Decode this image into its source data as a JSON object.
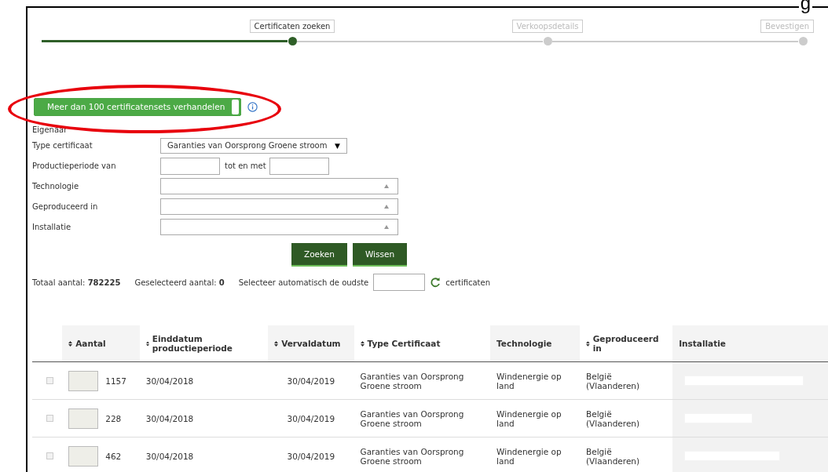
{
  "caption_fragment": "g",
  "steps": [
    {
      "label": "Certificaten zoeken",
      "selected": true
    },
    {
      "label": "Verkoopsdetails",
      "selected": false
    },
    {
      "label": "Bevestigen",
      "selected": false
    }
  ],
  "bulk_toggle": {
    "label": "Meer dan 100 certificatensets verhandelen",
    "on": true
  },
  "annotation": {
    "highlighted": true
  },
  "form": {
    "owner_label": "Eigenaar",
    "type_label": "Type certificaat",
    "type_value": "Garanties van Oorsprong Groene stroom",
    "type_arrow": "▼",
    "period_label": "Productieperiode van",
    "period_to_label": "tot en met",
    "fields": [
      {
        "label": "Technologie"
      },
      {
        "label": "Geproduceerd in"
      },
      {
        "label": "Installatie"
      }
    ]
  },
  "buttons": [
    "Zoeken",
    "Wissen"
  ],
  "summary": {
    "total_label": "Totaal aantal:",
    "total": "782225",
    "selected_label": "Geselecteerd aantal:",
    "selected": "0",
    "auto_label": "Selecteer automatisch de oudste",
    "auto_suffix": "certificaten"
  },
  "table": {
    "columns": [
      {
        "label": "Aantal",
        "sortable": true
      },
      {
        "label": "Einddatum productieperiode",
        "sortable": true
      },
      {
        "label": "Vervaldatum",
        "sortable": true
      },
      {
        "label": "Type Certificaat",
        "sortable": true
      },
      {
        "label": "Technologie",
        "sortable": false
      },
      {
        "label": "Geproduceerd in",
        "sortable": true
      },
      {
        "label": "Installatie",
        "sortable": false
      }
    ],
    "rows": [
      {
        "checked": false,
        "quantity": "1157",
        "end_date": "30/04/2018",
        "expiry": "30/04/2019",
        "type": "Garanties van Oorsprong Groene stroom",
        "technology": "Windenergie op land",
        "produced_in": "België (Vlaanderen)"
      },
      {
        "checked": false,
        "quantity": "228",
        "end_date": "30/04/2018",
        "expiry": "30/04/2019",
        "type": "Garanties van Oorsprong Groene stroom",
        "technology": "Windenergie op land",
        "produced_in": "België (Vlaanderen)"
      },
      {
        "checked": false,
        "quantity": "462",
        "end_date": "30/04/2018",
        "expiry": "30/04/2019",
        "type": "Garanties van Oorsprong Groene stroom",
        "technology": "Windenergie op land",
        "produced_in": "België (Vlaanderen)"
      }
    ]
  }
}
